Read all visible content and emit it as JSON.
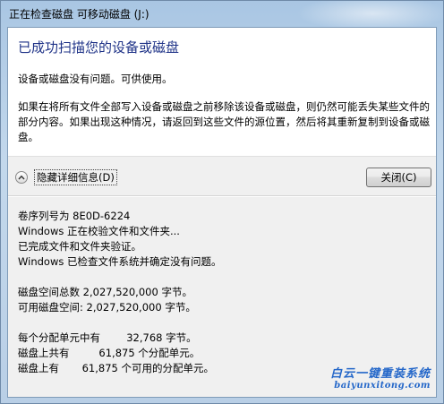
{
  "window": {
    "title": "正在检查磁盘 可移动磁盘 (J:)"
  },
  "summary": {
    "headline": "已成功扫描您的设备或磁盘",
    "status": "设备或磁盘没有问题。可供使用。",
    "warning": "如果在将所有文件全部写入设备或磁盘之前移除该设备或磁盘，则仍然可能丢失某些文件的部分内容。如果出现这种情况，请返回到这些文件的源位置，然后将其重新复制到设备或磁盘。"
  },
  "controls": {
    "toggle_details_label": "隐藏详细信息(D)",
    "close_label": "关闭(C)"
  },
  "details": {
    "serial": "卷序列号为 8E0D-6224",
    "verify_line": "Windows 正在校验文件和文件夹...",
    "verify_done": "已完成文件和文件夹验证。",
    "no_problems": "Windows 已检查文件系统并确定没有问题。",
    "total_space": "磁盘空间总数 2,027,520,000 字节。",
    "free_space": "可用磁盘空间: 2,027,520,000 字节。",
    "unit_size": "每个分配单元中有        32,768 字节。",
    "total_units": "磁盘上共有         61,875 个分配单元。",
    "free_units": "磁盘上有       61,875 个可用的分配单元。"
  },
  "watermark": {
    "title": "白云一键重装系统",
    "url": "baiyunxitong.com"
  },
  "colors": {
    "headline": "#1e3287",
    "frame": "#b9cfe6",
    "watermark": "#2467c9"
  }
}
